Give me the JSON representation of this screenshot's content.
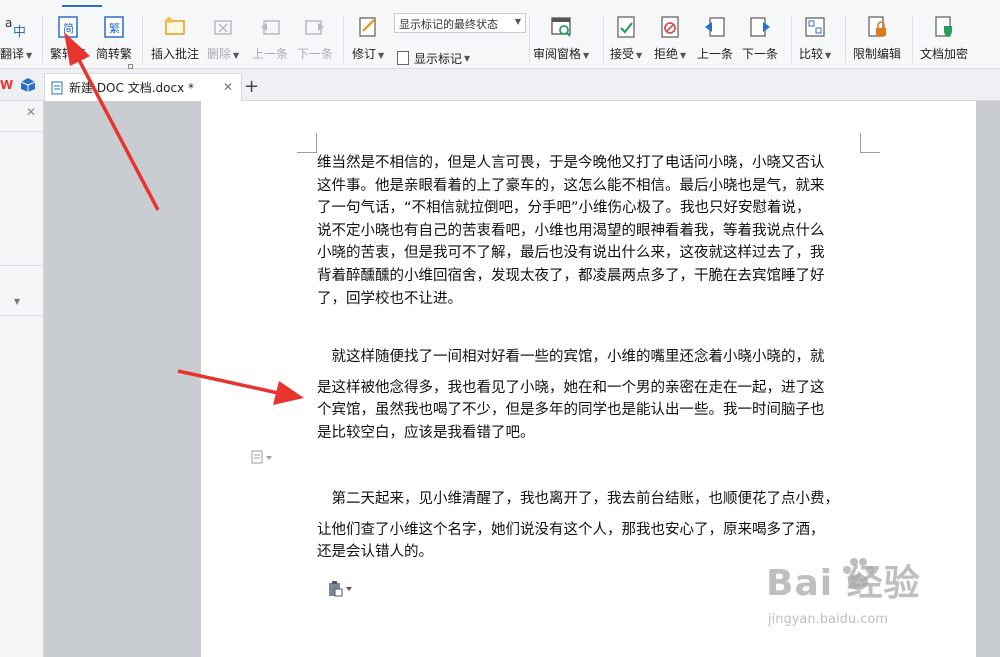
{
  "ribbon": {
    "translate": "翻译",
    "trad_to_simp": "繁转简",
    "simp_to_trad": "简转繁",
    "insert_comment": "插入批注",
    "delete": "删除",
    "prev_item": "上一条",
    "next_item": "下一条",
    "revise": "修订",
    "markup_select": "显示标记的最终状态",
    "show_markup": "显示标记",
    "review_pane": "审阅窗格",
    "accept": "接受",
    "reject": "拒绝",
    "prev": "上一条",
    "next": "下一条",
    "compare": "比较",
    "restrict_edit": "限制编辑",
    "doc_encrypt": "文档加密"
  },
  "doc_tab": {
    "title": "新建 DOC 文档.docx *"
  },
  "document": {
    "p1": [
      "维当然是不相信的，但是人言可畏，于是今晚他又打了电话问小晓，小晓又否认",
      "这件事。他是亲眼看着的上了豪车的，这怎么能不相信。最后小晓也是气，就来",
      "了一句气话，“不相信就拉倒吧，分手吧”小维伤心极了。我也只好安慰着说，",
      "说不定小晓也有自己的苦衷看吧，小维也用渴望的眼神看着我，等着我说点什么",
      "小晓的苦衷，但是我可不了解，最后也没有说出什么来，这夜就这样过去了，我",
      "背着醉醺醺的小维回宿舍，发现太夜了，都凌晨两点多了，干脆在去宾馆睡了好",
      "了，回学校也不让进。"
    ],
    "p2": [
      "　就这样随便找了一间相对好看一些的宾馆，小维的嘴里还念着小晓小晓的，就",
      "是这样被他念得多，我也看见了小晓，她在和一个男的亲密在走在一起，进了这",
      "个宾馆，虽然我也喝了不少，但是多年的同学也是能认出一些。我一时间脑子也",
      "是比较空白，应该是我看错了吧。"
    ],
    "p3": [
      "　第二天起来，见小维清醒了，我也离开了，我去前台结账，也顺便花了点小费，",
      "让他们查了小维这个名字，她们说没有这个人，那我也安心了，原来喝多了酒，",
      "还是会认错人的。"
    ]
  },
  "watermark": {
    "brand": "Bai  经验",
    "url": "jingyan.baidu.com"
  },
  "colors": {
    "accent": "#2b6fc7",
    "annotation_arrow": "#e8342e"
  }
}
